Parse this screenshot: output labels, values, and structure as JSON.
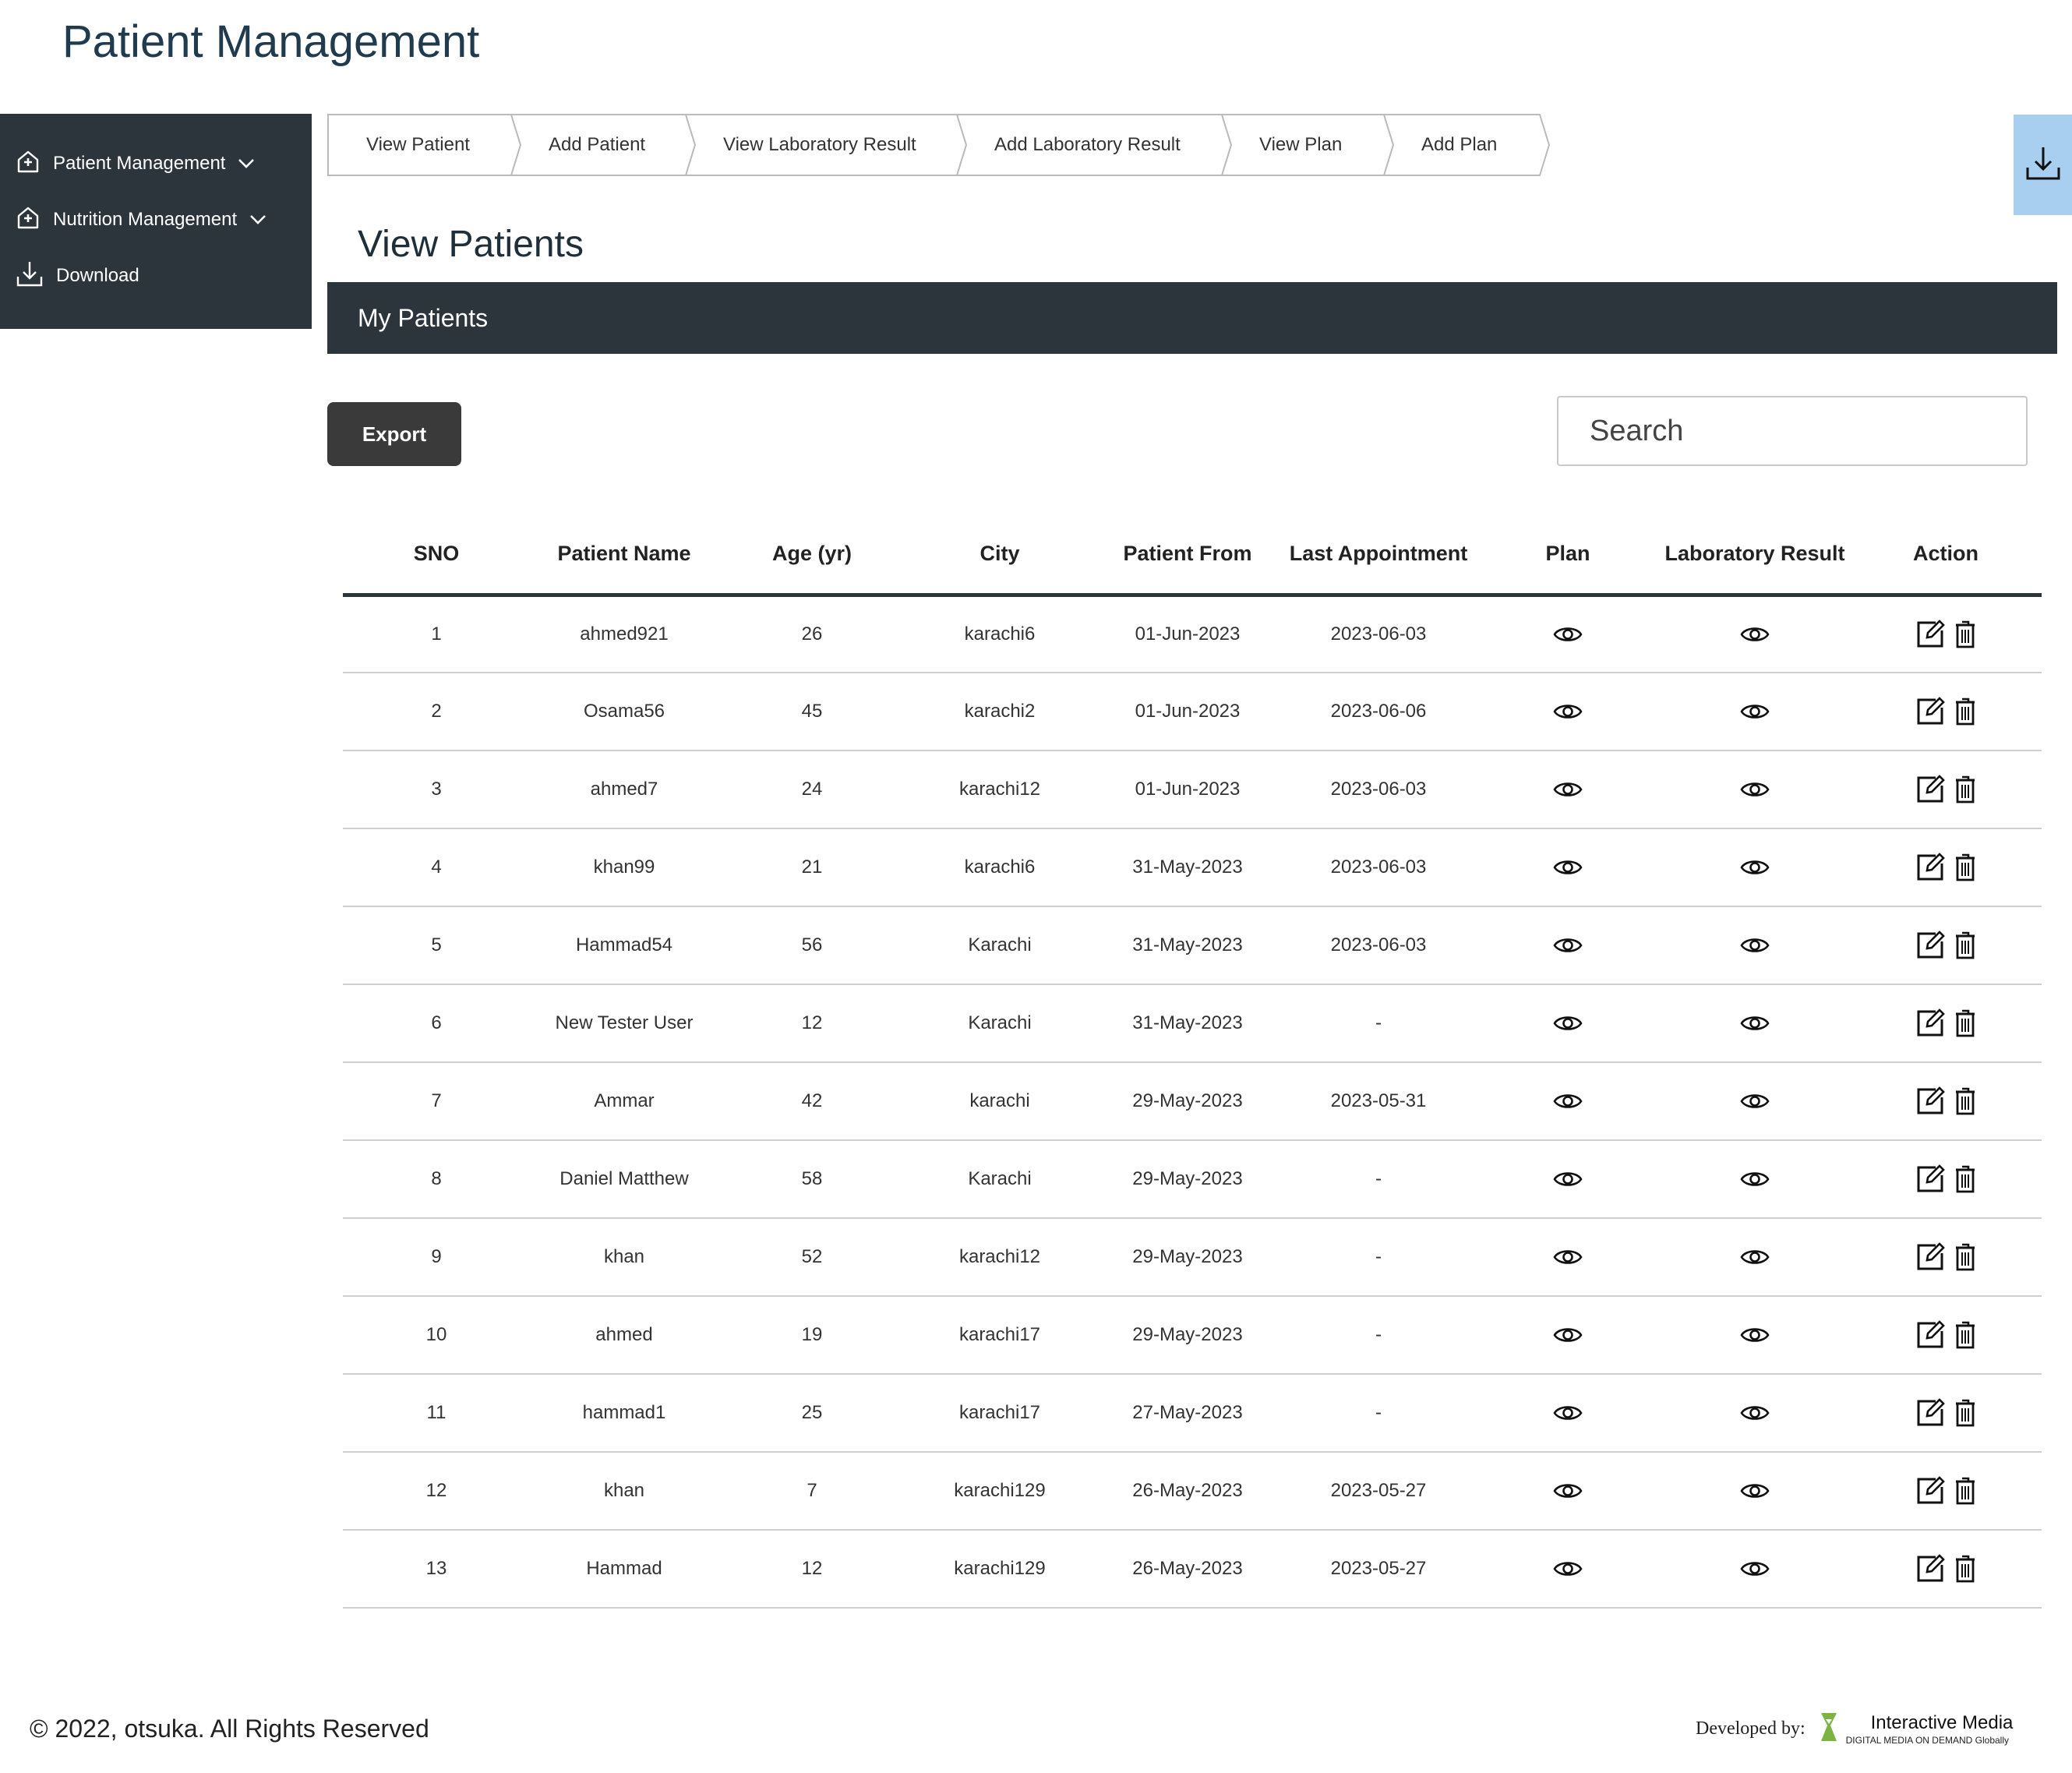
{
  "app": {
    "title": "Patient Management"
  },
  "sidebar": {
    "items": [
      {
        "label": "Patient Management",
        "icon": "hospital-icon",
        "has_chevron": true
      },
      {
        "label": "Nutrition Management",
        "icon": "hospital-icon",
        "has_chevron": true
      },
      {
        "label": "Download",
        "icon": "download-icon",
        "has_chevron": false
      }
    ]
  },
  "breadcrumb": {
    "items": [
      "View Patient",
      "Add Patient",
      "View Laboratory Result",
      "Add Laboratory Result",
      "View Plan",
      "Add Plan"
    ]
  },
  "page": {
    "title": "View Patients"
  },
  "card": {
    "header": "My Patients"
  },
  "toolbar": {
    "export_label": "Export",
    "search_placeholder": "Search"
  },
  "table": {
    "columns": [
      "SNO",
      "Patient Name",
      "Age (yr)",
      "City",
      "Patient From",
      "Last Appointment",
      "Plan",
      "Laboratory Result",
      "Action"
    ],
    "rows": [
      {
        "sno": "1",
        "name": "ahmed921",
        "age": "26",
        "city": "karachi6",
        "from": "01-Jun-2023",
        "last": "2023-06-03"
      },
      {
        "sno": "2",
        "name": "Osama56",
        "age": "45",
        "city": "karachi2",
        "from": "01-Jun-2023",
        "last": "2023-06-06"
      },
      {
        "sno": "3",
        "name": "ahmed7",
        "age": "24",
        "city": "karachi12",
        "from": "01-Jun-2023",
        "last": "2023-06-03"
      },
      {
        "sno": "4",
        "name": "khan99",
        "age": "21",
        "city": "karachi6",
        "from": "31-May-2023",
        "last": "2023-06-03"
      },
      {
        "sno": "5",
        "name": "Hammad54",
        "age": "56",
        "city": "Karachi",
        "from": "31-May-2023",
        "last": "2023-06-03"
      },
      {
        "sno": "6",
        "name": "New Tester User",
        "age": "12",
        "city": "Karachi",
        "from": "31-May-2023",
        "last": "-"
      },
      {
        "sno": "7",
        "name": "Ammar",
        "age": "42",
        "city": "karachi",
        "from": "29-May-2023",
        "last": "2023-05-31"
      },
      {
        "sno": "8",
        "name": "Daniel Matthew",
        "age": "58",
        "city": "Karachi",
        "from": "29-May-2023",
        "last": "-"
      },
      {
        "sno": "9",
        "name": "khan",
        "age": "52",
        "city": "karachi12",
        "from": "29-May-2023",
        "last": "-"
      },
      {
        "sno": "10",
        "name": "ahmed",
        "age": "19",
        "city": "karachi17",
        "from": "29-May-2023",
        "last": "-"
      },
      {
        "sno": "11",
        "name": "hammad1",
        "age": "25",
        "city": "karachi17",
        "from": "27-May-2023",
        "last": "-"
      },
      {
        "sno": "12",
        "name": "khan",
        "age": "7",
        "city": "karachi129",
        "from": "26-May-2023",
        "last": "2023-05-27"
      },
      {
        "sno": "13",
        "name": "Hammad",
        "age": "12",
        "city": "karachi129",
        "from": "26-May-2023",
        "last": "2023-05-27"
      }
    ]
  },
  "footer": {
    "copyright": "© 2022, otsuka. All Rights Reserved",
    "developed_by": "Developed by:",
    "brand_name": "Interactive Media",
    "brand_tagline": "DIGITAL MEDIA ON DEMAND Globally"
  },
  "colors": {
    "dark_panel": "#2c343c",
    "title_blue": "#1f3b4d",
    "download_tab": "#a9cff0",
    "export_button": "#3a3a3a",
    "brand_green": "#7cb342"
  }
}
